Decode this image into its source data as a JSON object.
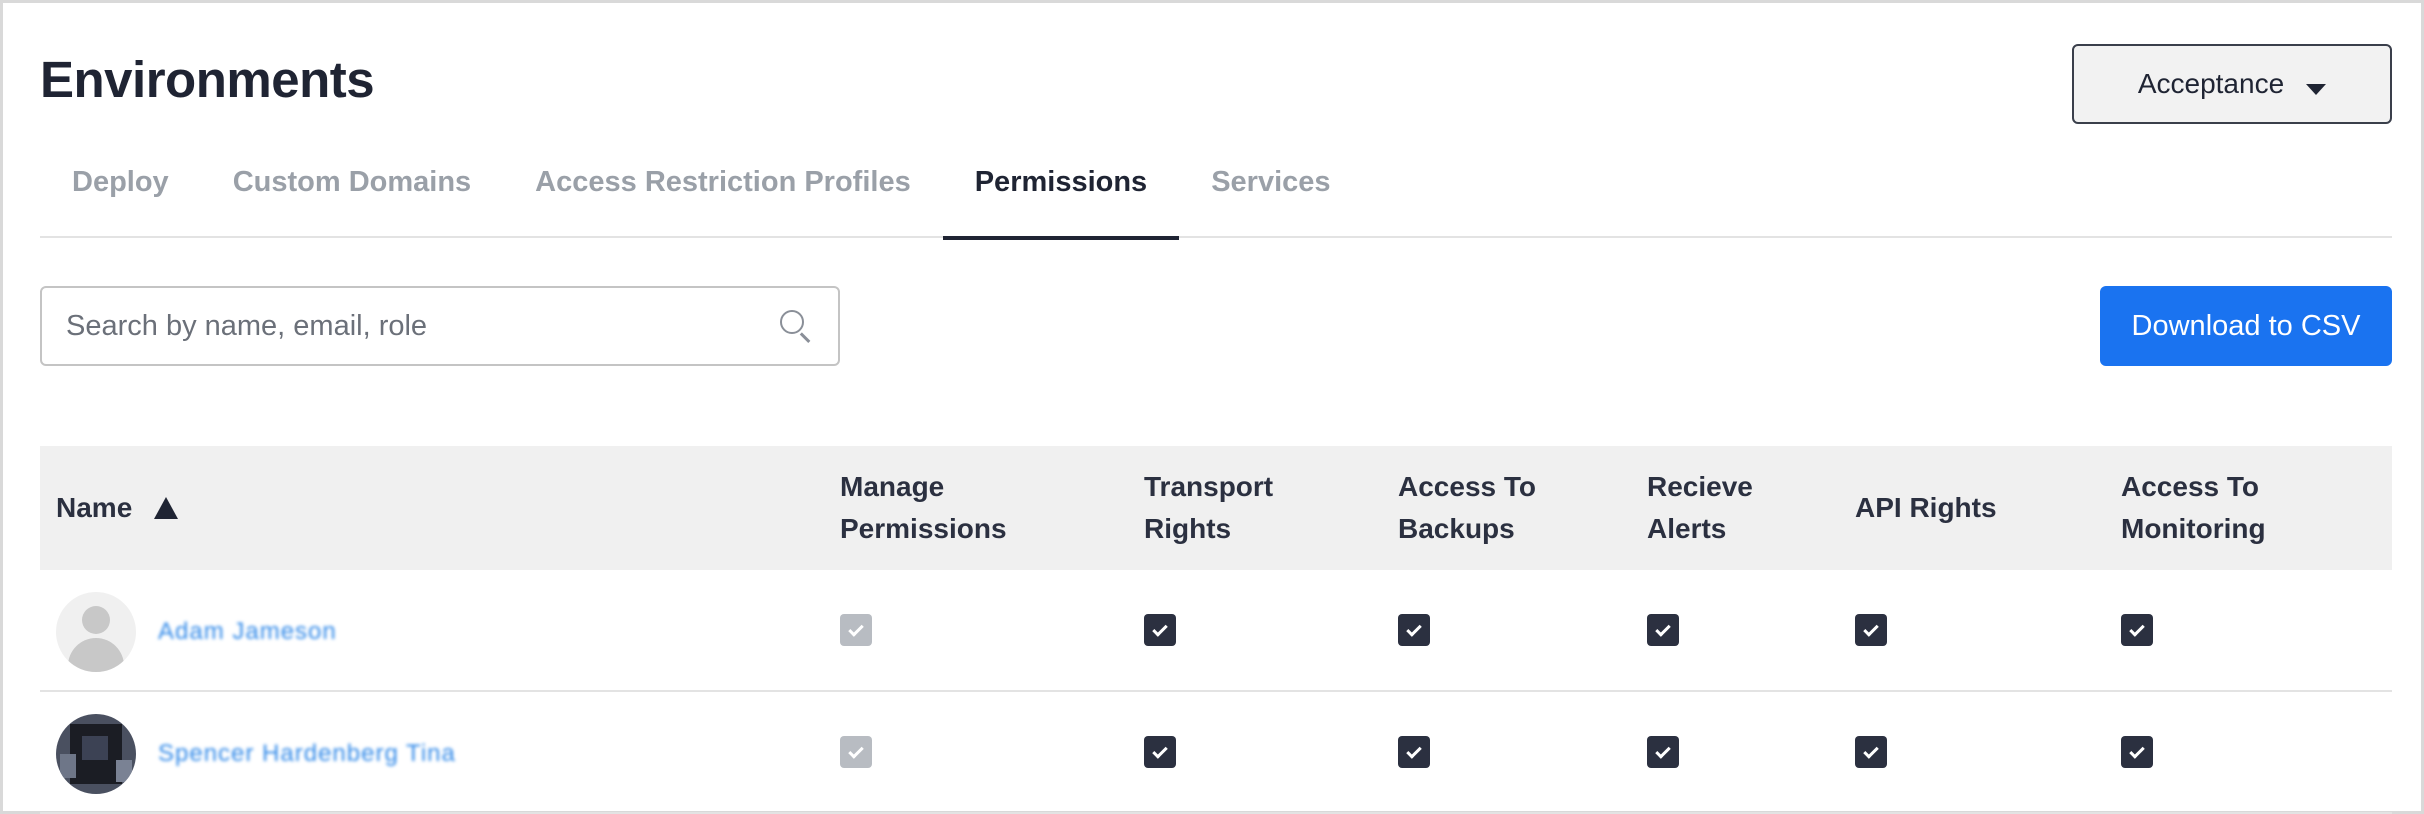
{
  "header": {
    "title": "Environments",
    "environment_select": {
      "value": "Acceptance"
    }
  },
  "tabs": [
    {
      "label": "Deploy",
      "active": false
    },
    {
      "label": "Custom Domains",
      "active": false
    },
    {
      "label": "Access Restriction Profiles",
      "active": false
    },
    {
      "label": "Permissions",
      "active": true
    },
    {
      "label": "Services",
      "active": false
    }
  ],
  "toolbar": {
    "search_placeholder": "Search by name, email, role",
    "download_label": "Download to CSV",
    "primary_color": "#1a73f0"
  },
  "table": {
    "columns": [
      {
        "label": "Name",
        "sorted": "asc"
      },
      {
        "label": "Manage Permissions"
      },
      {
        "label": "Transport Rights"
      },
      {
        "label": "Access To Backups"
      },
      {
        "label": "Recieve Alerts"
      },
      {
        "label": "API Rights"
      },
      {
        "label": "Access To Monitoring"
      }
    ],
    "rows": [
      {
        "name": "Adam Jameson",
        "avatar": "default-avatar-icon",
        "permissions": [
          {
            "checked": true,
            "disabled": true
          },
          {
            "checked": true,
            "disabled": false
          },
          {
            "checked": true,
            "disabled": false
          },
          {
            "checked": true,
            "disabled": false
          },
          {
            "checked": true,
            "disabled": false
          },
          {
            "checked": true,
            "disabled": false
          }
        ]
      },
      {
        "name": "Spencer Hardenberg Tina",
        "avatar": "user-photo",
        "permissions": [
          {
            "checked": true,
            "disabled": true
          },
          {
            "checked": true,
            "disabled": false
          },
          {
            "checked": true,
            "disabled": false
          },
          {
            "checked": true,
            "disabled": false
          },
          {
            "checked": true,
            "disabled": false
          },
          {
            "checked": true,
            "disabled": false
          }
        ]
      }
    ]
  }
}
